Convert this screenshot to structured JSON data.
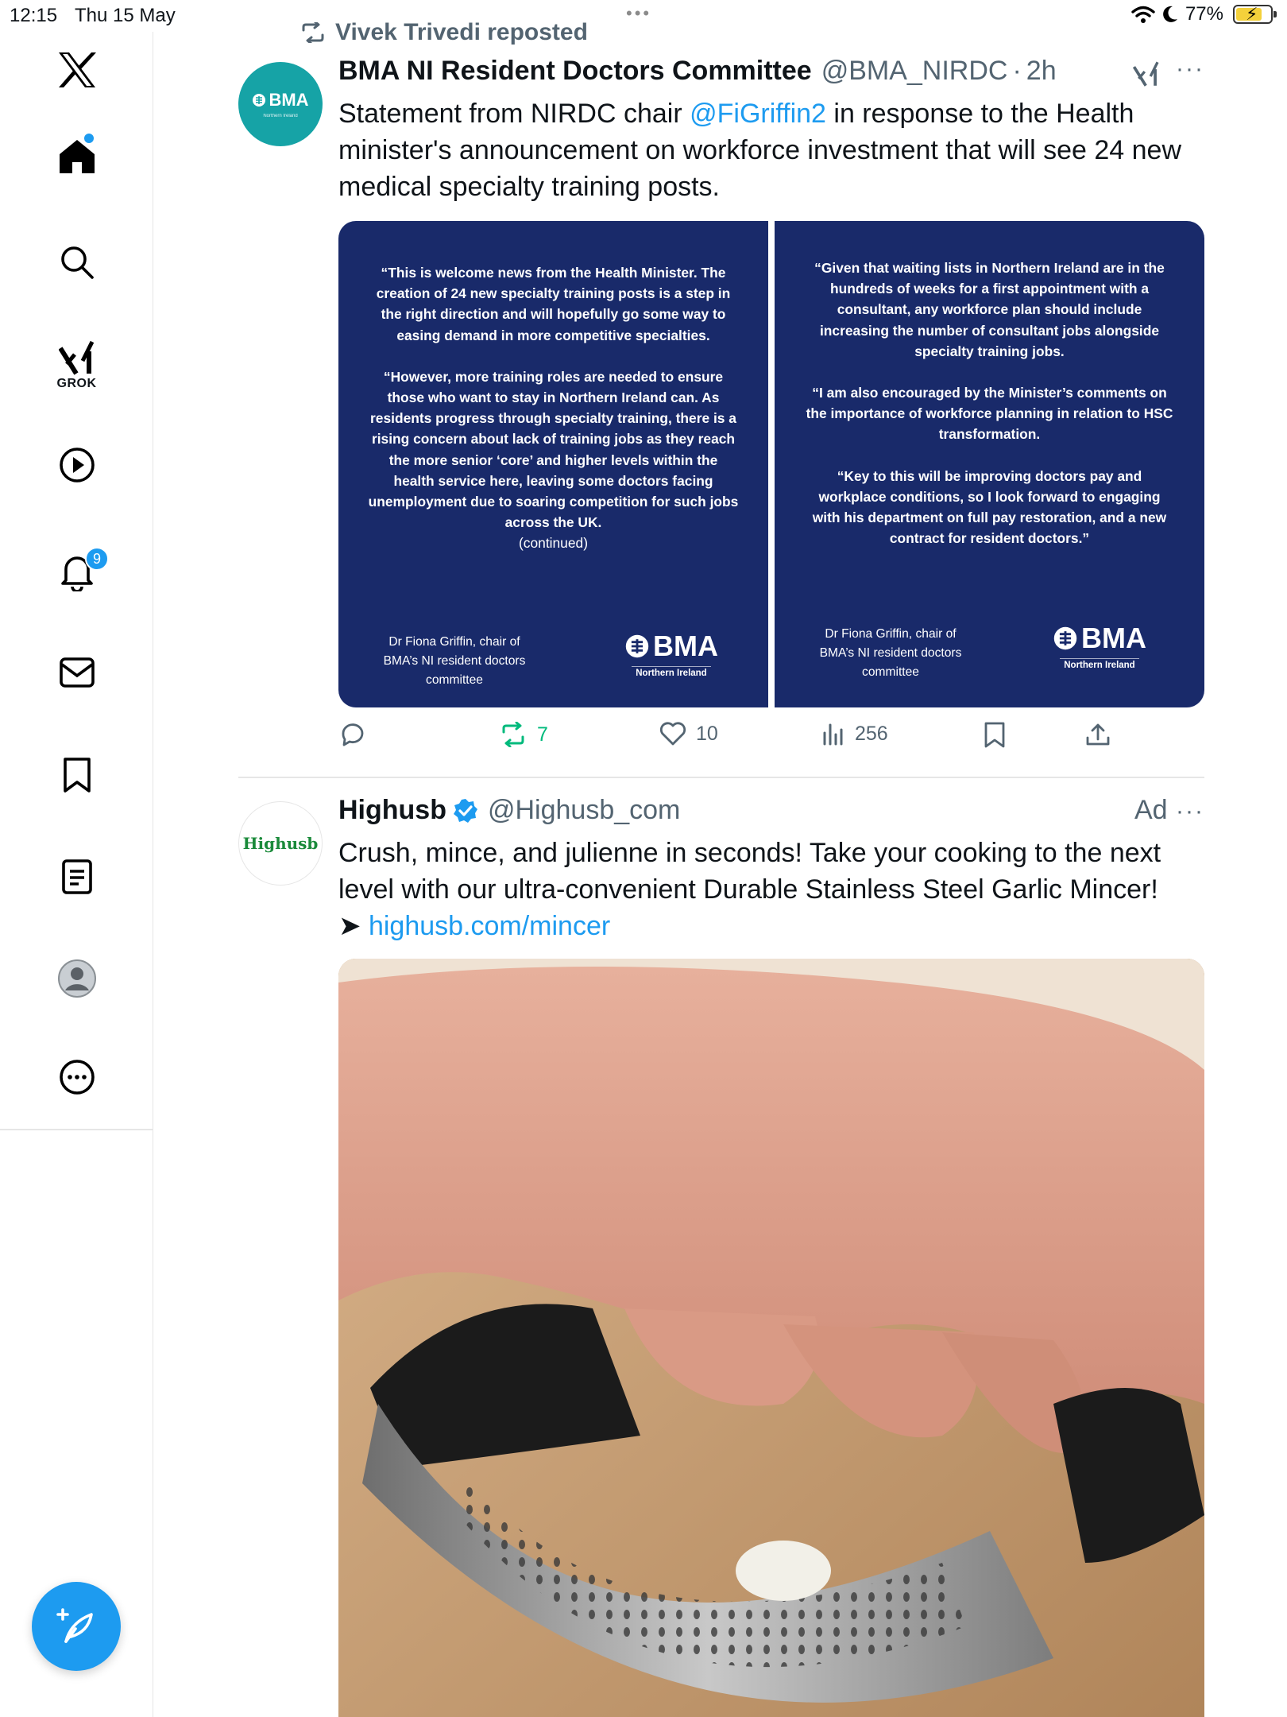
{
  "status_bar": {
    "time": "12:15",
    "date": "Thu 15 May",
    "battery_percent": "77%",
    "battery_level": 0.77
  },
  "sidebar": {
    "grok_label": "GROK",
    "notification_count": "9"
  },
  "posts": [
    {
      "repost_label": "Vivek Trivedi reposted",
      "avatar_text": "BMA",
      "avatar_subtext": "Northern Ireland",
      "author_name": "BMA NI Resident Doctors Committee",
      "author_handle": "@BMA_NIRDC",
      "separator": "·",
      "time_ago": "2h",
      "text_before": "Statement from NIRDC chair ",
      "mention": "@FiGriffin2",
      "text_after": " in response to the Health minister's announcement on workforce investment that will see 24 new medical specialty training posts.",
      "media": [
        {
          "paragraphs": [
            "“This is welcome news from the Health Minister. The creation of 24 new specialty training posts is a step in the right direction and will hopefully go some way to easing demand in more competitive specialties.",
            "“However, more training roles are needed to ensure those who want to stay in Northern Ireland can. As residents progress through specialty training, there is a rising concern about lack of training jobs as they reach the more senior ‘core’ and higher levels within the health service here, leaving some doctors facing unemployment due to soaring competition for such jobs across the UK."
          ],
          "continued": "(continued)",
          "signature": "Dr Fiona Griffin, chair of BMA’s NI resident doctors committee",
          "logo_text": "BMA",
          "logo_subtext": "Northern Ireland"
        },
        {
          "paragraphs": [
            "“Given that waiting lists in Northern Ireland are in the hundreds of weeks for a first appointment with a consultant, any workforce plan should include increasing the number of consultant jobs alongside specialty training jobs.",
            "“I am also encouraged by the Minister’s comments on the importance of workforce planning in relation to HSC transformation.",
            "“Key to this will be improving doctors pay and workplace conditions, so I look forward to engaging with his department on full pay restoration, and a new contract for resident doctors.”"
          ],
          "signature": "Dr Fiona Griffin, chair of BMA’s NI resident doctors committee",
          "logo_text": "BMA",
          "logo_subtext": "Northern Ireland"
        }
      ],
      "stats": {
        "reposts": "7",
        "likes": "10",
        "views": "256"
      },
      "reposted_by_me": true
    },
    {
      "avatar_text": "Highusb",
      "author_name": "Highusb",
      "verified": true,
      "author_handle": "@Highusb_com",
      "ad_label": "Ad",
      "text_line1": "Crush, mince, and julienne in seconds!  Take your cooking to the next level with our ultra-convenient Durable Stainless Steel Garlic Mincer!",
      "arrow": "➤",
      "link": "highusb.com/mincer"
    }
  ],
  "colors": {
    "accent": "#1d9bf0",
    "repost_green": "#00ba7c",
    "bma_navy": "#192a6a",
    "bma_teal": "#16a3a6",
    "secondary_text": "#536471"
  },
  "icons": [
    "x-logo-icon",
    "home-icon",
    "search-icon",
    "grok-icon",
    "video-icon",
    "bell-icon",
    "mail-icon",
    "bookmark-icon",
    "list-icon",
    "profile-icon",
    "more-circle-icon",
    "compose-icon",
    "reply-icon",
    "repost-icon",
    "like-icon",
    "views-icon",
    "share-icon",
    "verified-badge-icon"
  ]
}
